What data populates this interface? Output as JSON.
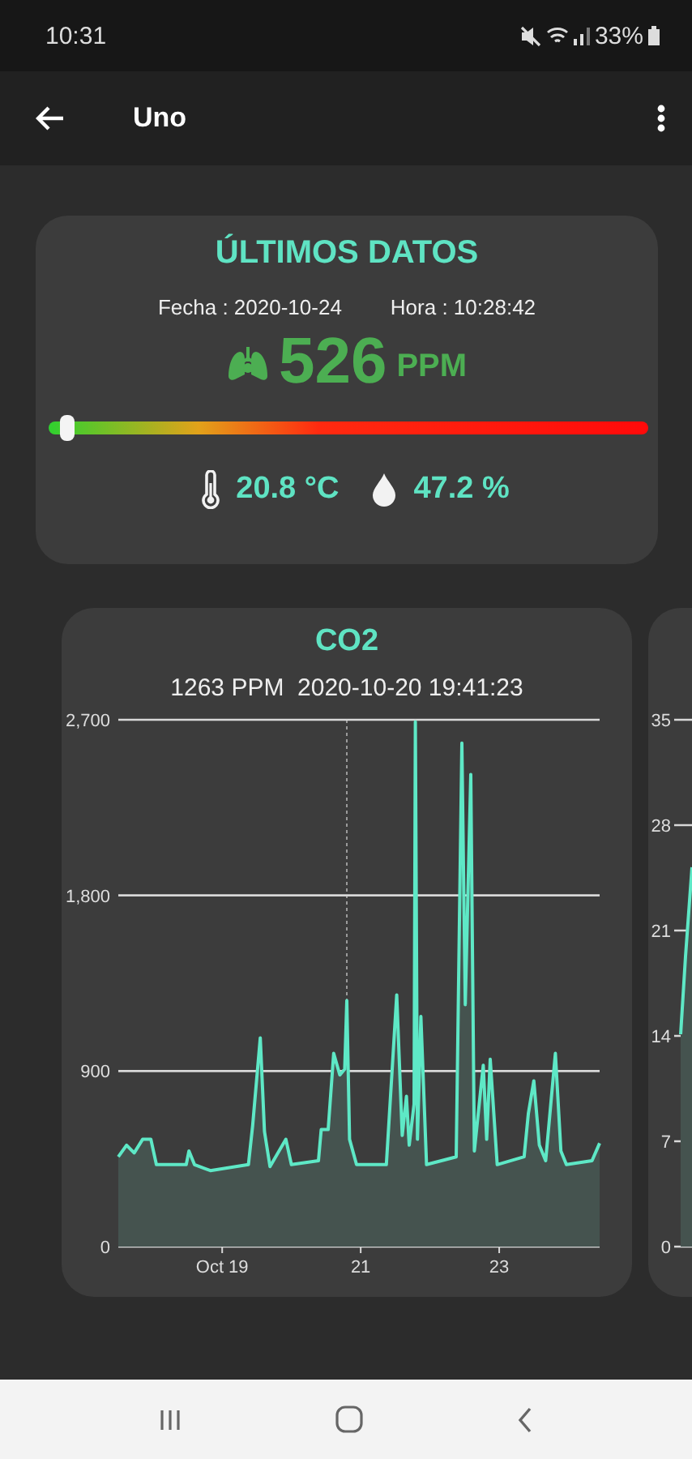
{
  "status_bar": {
    "time": "10:31",
    "battery": "33%"
  },
  "app_bar": {
    "title": "Uno"
  },
  "latest": {
    "title": "ÚLTIMOS DATOS",
    "date": "Fecha : 2020-10-24",
    "time": "Hora : 10:28:42",
    "co2": "526",
    "co2_unit": "PPM",
    "level": 0.03,
    "temperature": "20.8 °C",
    "humidity": "47.2 %"
  },
  "charts": [
    {
      "title": "CO2",
      "reading": "1263 PPM  2020-10-20 19:41:23",
      "chart_data": {
        "type": "area",
        "xlim": [
          17.5,
          24.45
        ],
        "ylim": [
          0,
          2700
        ],
        "xticks": [
          {
            "value": 19,
            "label": "Oct 19"
          },
          {
            "value": 21,
            "label": "21"
          },
          {
            "value": 23,
            "label": "23"
          }
        ],
        "yticks": [
          {
            "value": 0,
            "label": "0"
          },
          {
            "value": 900,
            "label": "900"
          },
          {
            "value": 1800,
            "label": "1,800"
          },
          {
            "value": 2700,
            "label": "2,700"
          }
        ],
        "x": [
          17.5,
          17.62,
          17.73,
          17.85,
          17.97,
          18.05,
          18.48,
          18.52,
          18.6,
          18.83,
          19.38,
          19.44,
          19.55,
          19.61,
          19.69,
          19.92,
          20.0,
          20.39,
          20.43,
          20.53,
          20.61,
          20.7,
          20.77,
          20.8,
          20.84,
          20.94,
          21.37,
          21.52,
          21.6,
          21.66,
          21.7,
          21.77,
          21.79,
          21.82,
          21.87,
          21.95,
          22.38,
          22.46,
          22.51,
          22.59,
          22.64,
          22.77,
          22.82,
          22.87,
          22.97,
          23.36,
          23.42,
          23.5,
          23.58,
          23.67,
          23.81,
          23.89,
          23.97,
          24.34,
          24.45
        ],
        "series": [
          {
            "color": "#5ee8c6",
            "values": [
              460,
              520,
              480,
              550,
              550,
              420,
              420,
              490,
              420,
              390,
              420,
              620,
              1070,
              590,
              410,
              550,
              420,
              440,
              600,
              600,
              990,
              880,
              910,
              1260,
              550,
              420,
              420,
              1290,
              570,
              770,
              520,
              730,
              2690,
              550,
              1180,
              420,
              460,
              2580,
              1240,
              2420,
              490,
              930,
              550,
              960,
              420,
              460,
              680,
              850,
              520,
              440,
              990,
              490,
              420,
              440,
              530
            ]
          }
        ]
      }
    },
    {
      "axis_labels": [
        "35",
        "28",
        "21",
        "14",
        "7",
        "0"
      ]
    }
  ]
}
